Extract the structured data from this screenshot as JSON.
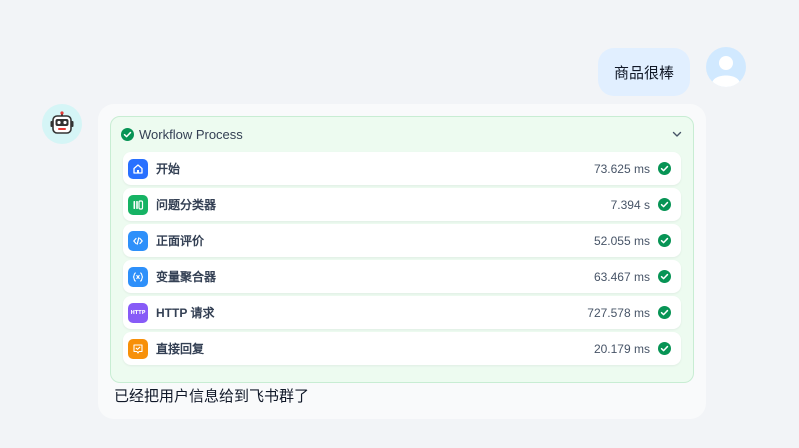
{
  "user_message": {
    "text": "商品很棒"
  },
  "workflow": {
    "title": "Workflow Process",
    "nodes": [
      {
        "name": "开始",
        "time": "73.625 ms",
        "icon": "home-icon",
        "color": "#2970ff"
      },
      {
        "name": "问题分类器",
        "time": "7.394 s",
        "icon": "classifier-icon",
        "color": "#16b364"
      },
      {
        "name": "正面评价",
        "time": "52.055 ms",
        "icon": "code-icon",
        "color": "#2e90fa"
      },
      {
        "name": "变量聚合器",
        "time": "63.467 ms",
        "icon": "variable-icon",
        "color": "#2e90fa"
      },
      {
        "name": "HTTP 请求",
        "time": "727.578 ms",
        "icon": "http-icon",
        "color": "#875bf7",
        "icon_text": "HTTP"
      },
      {
        "name": "直接回复",
        "time": "20.179 ms",
        "icon": "answer-icon",
        "color": "#f79009"
      }
    ],
    "success_color": "#079455"
  },
  "bot_reply": {
    "text": "已经把用户信息给到飞书群了"
  }
}
